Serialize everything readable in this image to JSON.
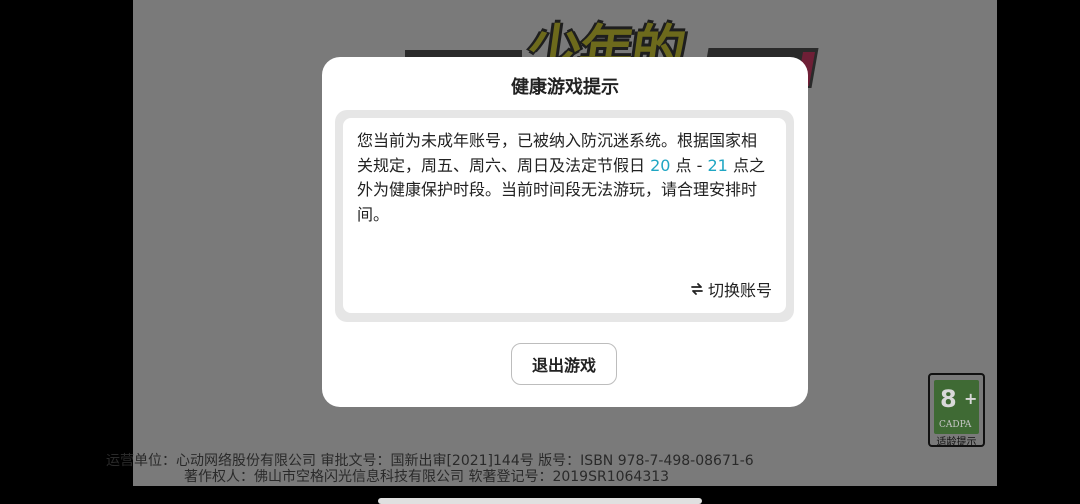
{
  "modal": {
    "title": "健康游戏提示",
    "notice_before_start": "您当前为未成年账号，已被纳入防沉迷系统。根据国家相关规定，周五、周六、周日及法定节假日 ",
    "start_hour": "20",
    "notice_between": " 点 - ",
    "end_hour": "21",
    "notice_after_end": " 点之外为健康保护时段。当前时间段无法游玩，请合理安排时间。",
    "switch_account_label": "切换账号",
    "exit_button_label": "退出游戏",
    "highlight_color": "#1fa6c3"
  },
  "background": {
    "logo_text": "少年的",
    "rating": {
      "age": "8",
      "plus": "+",
      "org": "CADPA",
      "label": "适龄提示"
    },
    "footer": {
      "line1": "运营单位：心动网络股份有限公司 审批文号：国新出审[2021]144号 版号：ISBN 978-7-498-08671-6",
      "line2": "著作权人：佛山市空格闪光信息科技有限公司 软著登记号：2019SR1064313"
    }
  }
}
